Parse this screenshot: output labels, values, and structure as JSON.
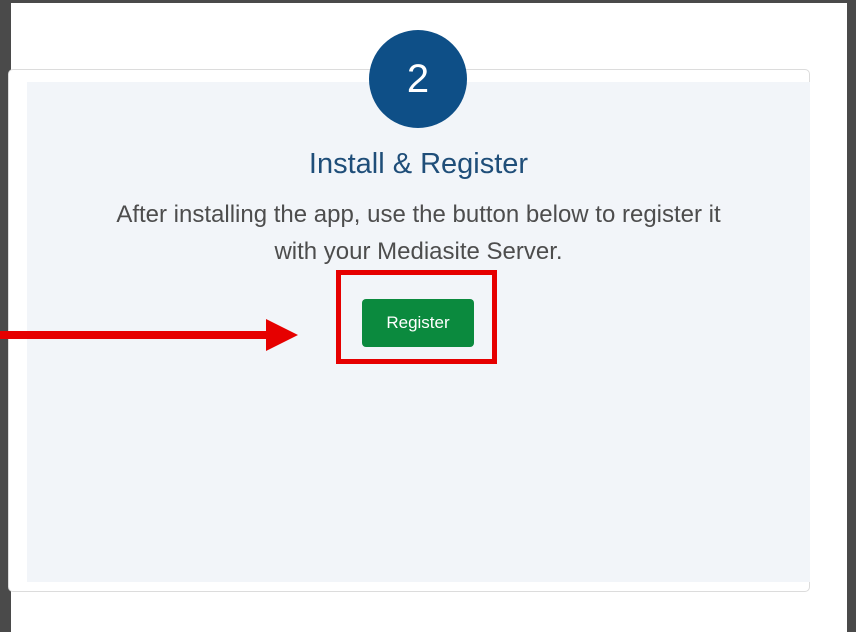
{
  "step": {
    "number": "2",
    "title": "Install & Register",
    "description_line1": "After installing the app, use the button below to register it",
    "description_line2": "with your Mediasite Server."
  },
  "actions": {
    "register_label": "Register"
  },
  "annotation": {
    "highlight_color": "#e60000",
    "arrow_color": "#e60000"
  },
  "colors": {
    "circle": "#0e4f87",
    "button": "#0b8a3e",
    "card_background": "#f2f5f9"
  }
}
